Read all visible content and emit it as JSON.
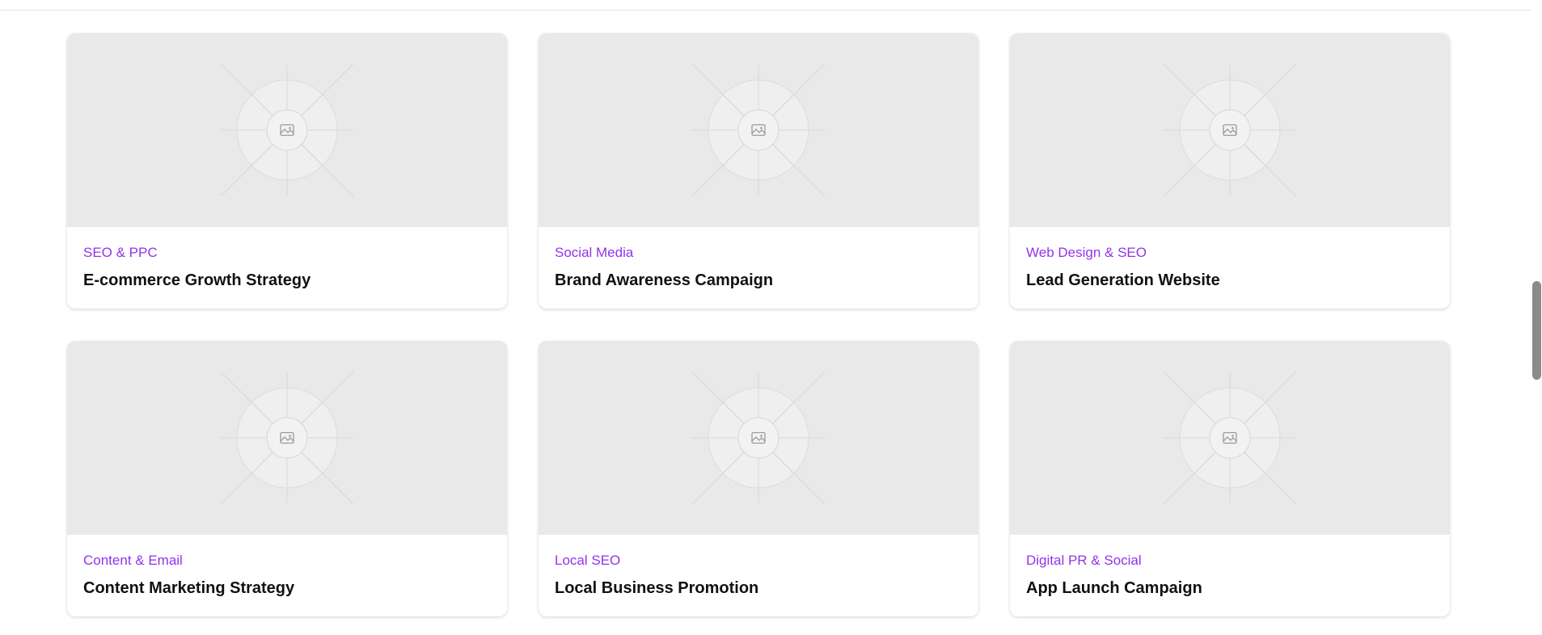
{
  "colors": {
    "accent": "#9333ea",
    "title": "#111111",
    "placeholder_bg": "#e9e9e9"
  },
  "projects": [
    {
      "category": "SEO & PPC",
      "title": "E-commerce Growth Strategy",
      "image_icon": "image-placeholder-icon"
    },
    {
      "category": "Social Media",
      "title": "Brand Awareness Campaign",
      "image_icon": "image-placeholder-icon"
    },
    {
      "category": "Web Design & SEO",
      "title": "Lead Generation Website",
      "image_icon": "image-placeholder-icon"
    },
    {
      "category": "Content & Email",
      "title": "Content Marketing Strategy",
      "image_icon": "image-placeholder-icon"
    },
    {
      "category": "Local SEO",
      "title": "Local Business Promotion",
      "image_icon": "image-placeholder-icon"
    },
    {
      "category": "Digital PR & Social",
      "title": "App Launch Campaign",
      "image_icon": "image-placeholder-icon"
    }
  ]
}
